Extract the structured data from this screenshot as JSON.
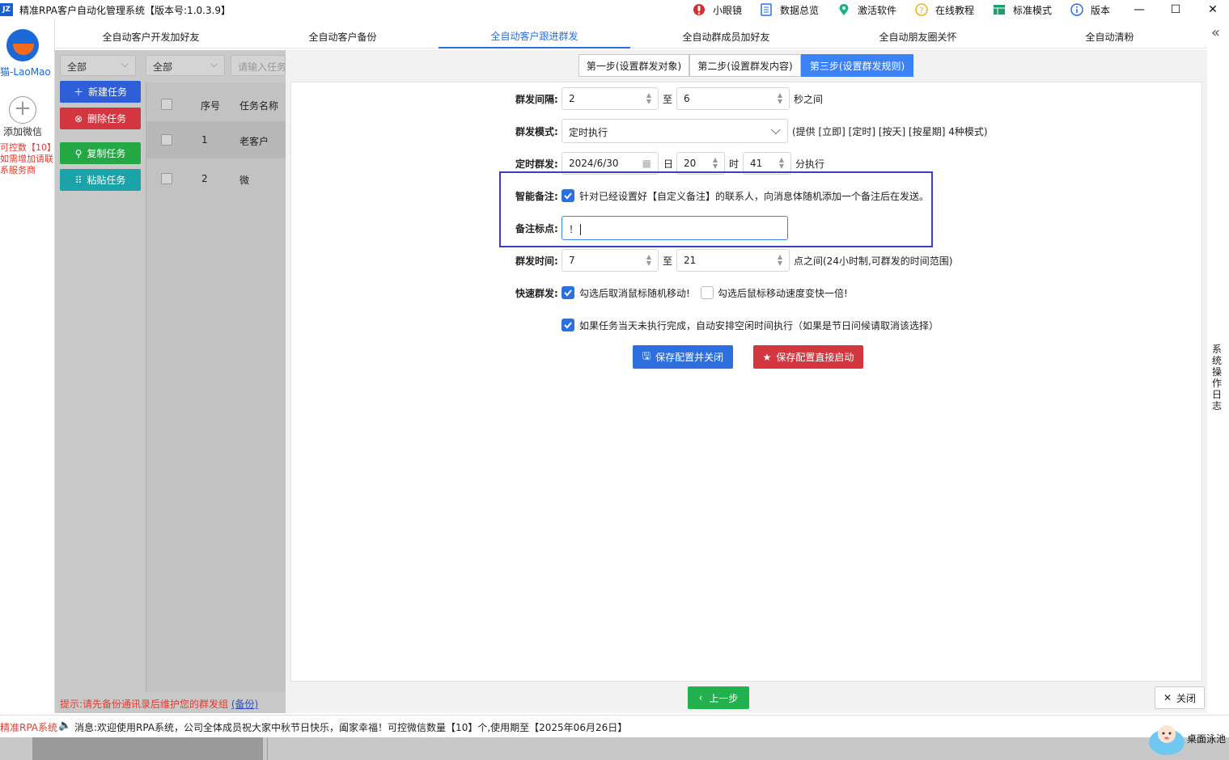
{
  "window": {
    "app_title": "精准RPA客户自动化管理系统【版本号:1.0.3.9】",
    "logo_text": "JZ"
  },
  "toolbar": {
    "items": [
      {
        "label": "小眼镜",
        "icon": "eye-icon"
      },
      {
        "label": "数据总览",
        "icon": "document-icon"
      },
      {
        "label": "激活软件",
        "icon": "location-pin-icon"
      },
      {
        "label": "在线教程",
        "icon": "help-icon"
      },
      {
        "label": "标准模式",
        "icon": "table-icon"
      },
      {
        "label": "版本",
        "icon": "info-icon"
      }
    ],
    "minimize": "—",
    "maximize": "☐",
    "close": "✕"
  },
  "tabs": [
    {
      "label": "全自动客户开发加好友"
    },
    {
      "label": "全自动客户备份"
    },
    {
      "label": "全自动客户跟进群发",
      "active": true
    },
    {
      "label": "全自动群成员加好友"
    },
    {
      "label": "全自动朋友圈关怀"
    },
    {
      "label": "全自动清粉"
    }
  ],
  "collapse_icon": "«",
  "sidebar": {
    "user_name": "猫-LaoMao",
    "add_wechat_label": "添加微信",
    "notes": [
      "可控数【10】",
      "如需增加请联",
      "系服务商"
    ]
  },
  "tasks": {
    "filter1": "全部",
    "filter2": "全部",
    "search_placeholder": "请输入任务",
    "buttons": {
      "new": "新建任务",
      "delete": "删除任务",
      "copy": "复制任务",
      "paste": "粘贴任务"
    },
    "columns": {
      "index": "序号",
      "name": "任务名称"
    },
    "rows": [
      {
        "index": "1",
        "name": "老客户"
      },
      {
        "index": "2",
        "name": "微"
      }
    ],
    "hint": "提示:请先备份通讯录后维护您的群发组",
    "hint_link": "(备份)"
  },
  "steps": [
    {
      "label": "第一步(设置群发对象)"
    },
    {
      "label": "第二步(设置群发内容)"
    },
    {
      "label": "第三步(设置群发规则)",
      "active": true
    }
  ],
  "form": {
    "interval": {
      "label": "群发间隔:",
      "from": "2",
      "to_word": "至",
      "to": "6",
      "suffix": "秒之间"
    },
    "mode": {
      "label": "群发模式:",
      "value": "定时执行",
      "note": "(提供 [立即] [定时] [按天] [按星期] 4种模式)"
    },
    "scheduled": {
      "label": "定时群发:",
      "date": "2024/6/30",
      "day_word": "日",
      "hour": "20",
      "hour_word": "时",
      "minute": "41",
      "minute_suffix": "分执行"
    },
    "smart_note": {
      "label": "智能备注:",
      "checked": true,
      "text": "针对已经设置好【自定义备注】的联系人，向消息体随机添加一个备注后在发送。"
    },
    "note_mark": {
      "label": "备注标点:",
      "value": "！"
    },
    "time_range": {
      "label": "群发时间:",
      "from": "7",
      "to_word": "至",
      "to": "21",
      "suffix": "点之间(24小时制,可群发的时间范围)"
    },
    "fast": {
      "label": "快速群发:",
      "opt1": "勾选后取消鼠标随机移动!",
      "opt1_checked": true,
      "opt2": "勾选后鼠标移动速度变快一倍!",
      "opt2_checked": false
    },
    "auto_resume": {
      "checked": true,
      "text": "如果任务当天未执行完成，自动安排空闲时间执行（如果是节日问候请取消该选择）"
    },
    "save_close": "保存配置并关闭",
    "save_start": "保存配置直接启动"
  },
  "footer": {
    "prev": "上一步",
    "close": "关闭",
    "syslog": "系统操作日志"
  },
  "statusbar": {
    "app": "精准RPA系统",
    "message": "消息:欢迎使用RPA系统，公司全体成员祝大家中秋节日快乐，阖家幸福！可控微信数量【10】个,使用期至【2025年06月26日】"
  },
  "desktop_pet_label": "桌面泳池",
  "colors": {
    "accent": "#2b6fe0",
    "new_btn": "#2e5fd8",
    "delete_btn": "#d3363e",
    "copy_btn": "#24a745",
    "paste_btn": "#1aa3a8",
    "prev_btn": "#22b14c",
    "save_close_btn": "#2b6fe0",
    "save_start_btn": "#d3363e",
    "highlight_box": "#3c3fbf"
  }
}
